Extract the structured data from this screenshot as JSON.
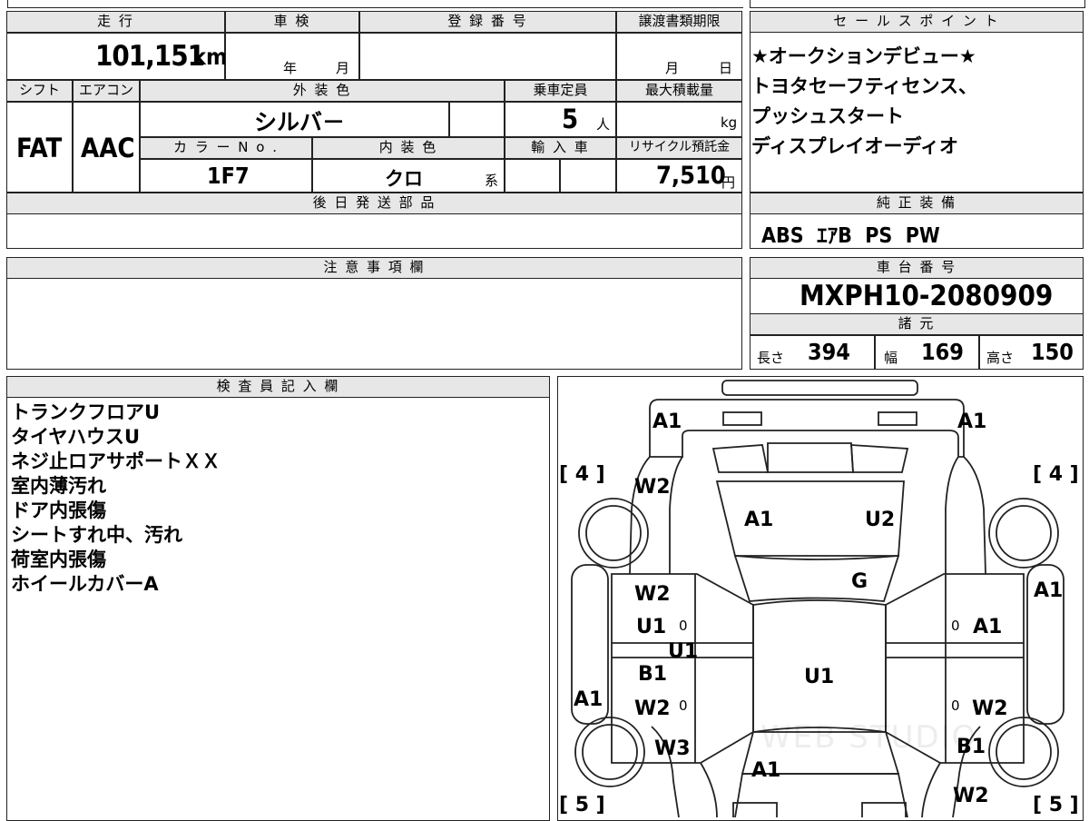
{
  "top_table": {
    "mileage_header": "走 行",
    "mileage_value": "101,151",
    "mileage_unit": "km",
    "shaken_header": "車 検",
    "shaken_year": "年",
    "shaken_month": "月",
    "reg_header": "登 録 番 号",
    "transfer_header": "譲渡書類期限",
    "transfer_month": "月",
    "transfer_day": "日",
    "shift_header": "シフト",
    "ac_header": "エアコン",
    "ext_color_header": "外 装 色",
    "capacity_header": "乗車定員",
    "maxload_header": "最大積載量",
    "shift_value": "FAT",
    "ac_value": "AAC",
    "ext_color_value": "シルバ－",
    "capacity_value": "5",
    "capacity_unit": "人",
    "maxload_unit": "kg",
    "color_no_header": "カ ラ ー N o .",
    "int_color_header": "内 装 色",
    "import_header": "輸 入 車",
    "recycle_header": "リサイクル預託金",
    "color_no_value": "1F7",
    "int_color_value": "クロ",
    "int_color_suffix": "系",
    "recycle_value": "7,510",
    "recycle_unit": "円",
    "later_parts_header": "後 日 発 送 部 品"
  },
  "sales_point": {
    "header": "セ ー ル ス ポ イ ン ト",
    "lines": [
      "★オークションデビュー★",
      "トヨタセーフティセンス、",
      "プッシュスタート",
      "ディスプレイオーディオ"
    ]
  },
  "genuine_equipment": {
    "header": "純 正 装 備",
    "value": "ABS  ｴｱB  PS  PW"
  },
  "caution": {
    "header": "注 意 事 項 欄"
  },
  "chassis": {
    "header": "車 台 番 号",
    "value": "MXPH10-2080909",
    "spec_header": "諸 元",
    "length_label": "長さ",
    "length_value": "394",
    "width_label": "幅",
    "width_value": "169",
    "height_label": "高さ",
    "height_value": "150"
  },
  "inspector": {
    "header": "検 査 員 記 入 欄",
    "notes": [
      "トランクフロアU",
      "タイヤハウスU",
      "ネジ止ロアサポートＸＸ",
      "室内薄汚れ",
      "ドア内張傷",
      "シートすれ中、汚れ",
      "荷室内張傷",
      "ホイールカバーA"
    ]
  },
  "diagram": {
    "left_tire_front": "[ 4 ]",
    "right_tire_front": "[ 4 ]",
    "left_tire_rear": "[ 5 ]",
    "right_tire_rear": "[ 5 ]",
    "marks": {
      "rear_left": "A1",
      "rear_right": "A1",
      "trunk_w2": "W2",
      "trunk_a1": "A1",
      "trunk_u2": "U2",
      "roof_g": "G",
      "left_door_w2": "W2",
      "left_door_u1": "U1",
      "left_door_zero_1": "0",
      "left_mid_u1": "U1",
      "left_door_b1": "B1",
      "left_door_w2b": "W2",
      "left_door_zero_2": "0",
      "left_side_a1": "A1",
      "roof_u1": "U1",
      "right_side_a1": "A1",
      "right_door_zero_1": "0",
      "right_door_a1": "A1",
      "right_door_zero_2": "0",
      "right_door_w2": "W2",
      "front_left_w3": "W3",
      "front_a1": "A1",
      "front_right_b1": "B1",
      "front_right_w2": "W2"
    },
    "watermark": "WEB STUDIO"
  }
}
